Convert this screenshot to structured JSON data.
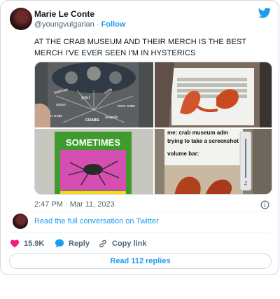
{
  "author": {
    "name": "Marie Le Conte",
    "handle": "@youngvulgarian",
    "separator": "·",
    "follow_label": "Follow"
  },
  "tweet": {
    "text": "AT THE CRAB MUSEUM AND THEIR MERCH IS THE BEST MERCH I'VE EVER SEEN I'M IN HYSTERICS"
  },
  "media": {
    "img1": {
      "labels": [
        "you!",
        "ladybugs",
        "crabs",
        "other crabs",
        "seagulls",
        "more crabs",
        "ocean",
        "CRABS"
      ]
    },
    "img3": {
      "title": "SOMETIMES"
    },
    "img4": {
      "line1": "me: crab museum adm",
      "line2": "trying to take a screenshot",
      "line3": "volume bar:"
    }
  },
  "timestamp": "2:47 PM · Mar 11, 2023",
  "read_conversation": "Read the full conversation on Twitter",
  "actions": {
    "likes": "15.9K",
    "reply": "Reply",
    "copy_link": "Copy link"
  },
  "read_replies": "Read 112 replies",
  "colors": {
    "accent": "#1d9bf0",
    "like": "#f91880",
    "text": "#0f1419",
    "muted": "#536471"
  },
  "icons": [
    "twitter-bird-icon",
    "info-icon",
    "heart-icon",
    "reply-bubble-icon",
    "link-icon"
  ]
}
